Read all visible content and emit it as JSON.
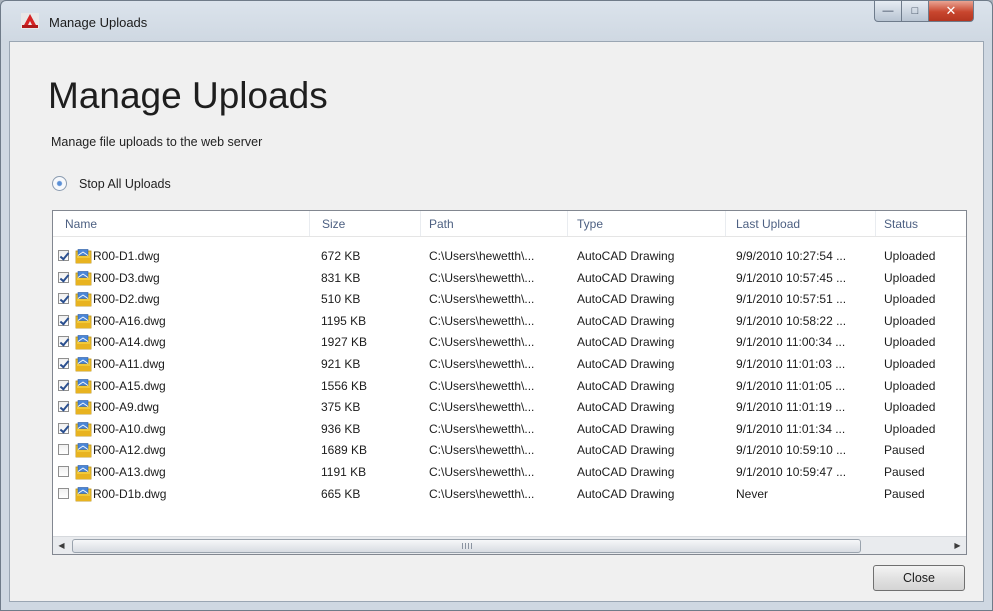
{
  "window": {
    "title": "Manage Uploads",
    "controls": {
      "minimize": "—",
      "maximize": "□",
      "close": "✕"
    }
  },
  "header": {
    "title": "Manage Uploads",
    "subtitle": "Manage file uploads to the web server"
  },
  "actions": {
    "stop_all": "Stop All Uploads"
  },
  "table": {
    "columns": [
      "Name",
      "Size",
      "Path",
      "Type",
      "Last Upload",
      "Status"
    ],
    "rows": [
      {
        "checked": true,
        "name": "R00-D1.dwg",
        "size": "672 KB",
        "path": "C:\\Users\\hewetth\\...",
        "type": "AutoCAD Drawing",
        "last_upload": "9/9/2010 10:27:54 ...",
        "status": "Uploaded"
      },
      {
        "checked": true,
        "name": "R00-D3.dwg",
        "size": "831 KB",
        "path": "C:\\Users\\hewetth\\...",
        "type": "AutoCAD Drawing",
        "last_upload": "9/1/2010 10:57:45 ...",
        "status": "Uploaded"
      },
      {
        "checked": true,
        "name": "R00-D2.dwg",
        "size": "510 KB",
        "path": "C:\\Users\\hewetth\\...",
        "type": "AutoCAD Drawing",
        "last_upload": "9/1/2010 10:57:51 ...",
        "status": "Uploaded"
      },
      {
        "checked": true,
        "name": "R00-A16.dwg",
        "size": "1195 KB",
        "path": "C:\\Users\\hewetth\\...",
        "type": "AutoCAD Drawing",
        "last_upload": "9/1/2010 10:58:22 ...",
        "status": "Uploaded"
      },
      {
        "checked": true,
        "name": "R00-A14.dwg",
        "size": "1927 KB",
        "path": "C:\\Users\\hewetth\\...",
        "type": "AutoCAD Drawing",
        "last_upload": "9/1/2010 11:00:34 ...",
        "status": "Uploaded"
      },
      {
        "checked": true,
        "name": "R00-A11.dwg",
        "size": "921 KB",
        "path": "C:\\Users\\hewetth\\...",
        "type": "AutoCAD Drawing",
        "last_upload": "9/1/2010 11:01:03 ...",
        "status": "Uploaded"
      },
      {
        "checked": true,
        "name": "R00-A15.dwg",
        "size": "1556 KB",
        "path": "C:\\Users\\hewetth\\...",
        "type": "AutoCAD Drawing",
        "last_upload": "9/1/2010 11:01:05 ...",
        "status": "Uploaded"
      },
      {
        "checked": true,
        "name": "R00-A9.dwg",
        "size": "375 KB",
        "path": "C:\\Users\\hewetth\\...",
        "type": "AutoCAD Drawing",
        "last_upload": "9/1/2010 11:01:19 ...",
        "status": "Uploaded"
      },
      {
        "checked": true,
        "name": "R00-A10.dwg",
        "size": "936 KB",
        "path": "C:\\Users\\hewetth\\...",
        "type": "AutoCAD Drawing",
        "last_upload": "9/1/2010 11:01:34 ...",
        "status": "Uploaded"
      },
      {
        "checked": false,
        "name": "R00-A12.dwg",
        "size": "1689 KB",
        "path": "C:\\Users\\hewetth\\...",
        "type": "AutoCAD Drawing",
        "last_upload": "9/1/2010 10:59:10 ...",
        "status": "Paused"
      },
      {
        "checked": false,
        "name": "R00-A13.dwg",
        "size": "1191 KB",
        "path": "C:\\Users\\hewetth\\...",
        "type": "AutoCAD Drawing",
        "last_upload": "9/1/2010 10:59:47 ...",
        "status": "Paused"
      },
      {
        "checked": false,
        "name": "R00-D1b.dwg",
        "size": "665 KB",
        "path": "C:\\Users\\hewetth\\...",
        "type": "AutoCAD Drawing",
        "last_upload": "Never",
        "status": "Paused"
      }
    ]
  },
  "scrollbar": {
    "left_arrow": "◀",
    "right_arrow": "▶"
  },
  "footer": {
    "close_label": "Close"
  },
  "icons": {
    "app": "autocad-app-icon",
    "file": "dwg-file-icon",
    "radio": "radio-selected-icon",
    "checkbox": "checkbox-icon"
  },
  "colors": {
    "header_text": "#4d6082",
    "close_red": "#c8462e",
    "checkmark": "#2a4f8f"
  }
}
